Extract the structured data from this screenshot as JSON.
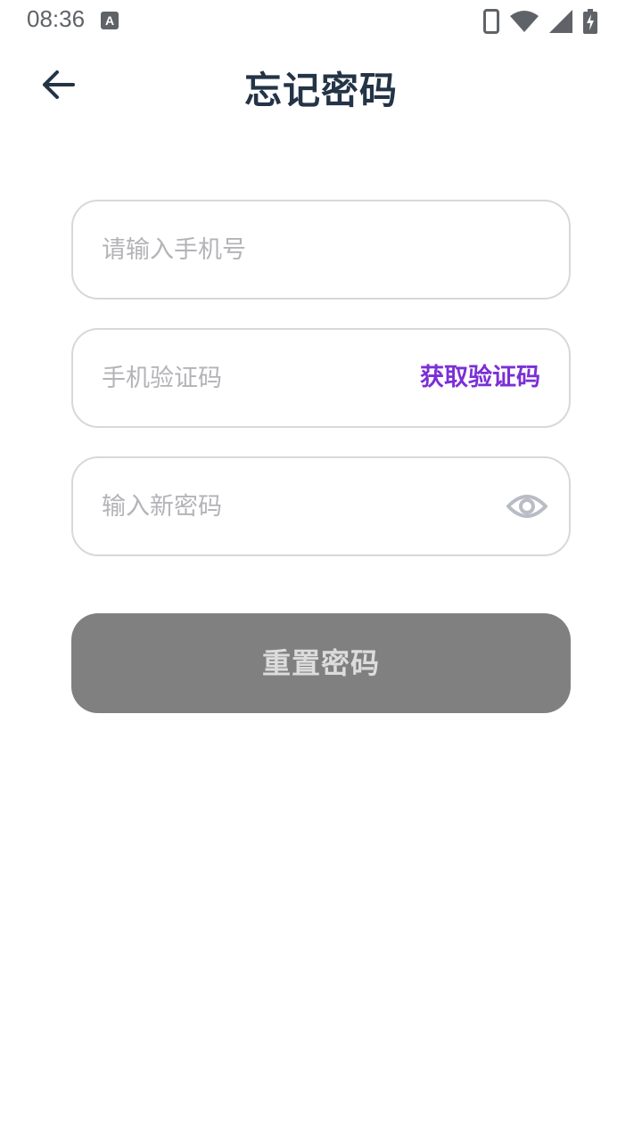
{
  "status_bar": {
    "time": "08:36",
    "notification_icon": "A",
    "icons": [
      "phone-icon",
      "wifi-icon",
      "signal-icon",
      "battery-charging-icon"
    ]
  },
  "header": {
    "title": "忘记密码",
    "back_icon": "arrow-left-icon"
  },
  "form": {
    "phone_placeholder": "请输入手机号",
    "code_placeholder": "手机验证码",
    "get_code_label": "获取验证码",
    "password_placeholder": "输入新密码",
    "password_toggle_icon": "eye-icon"
  },
  "actions": {
    "reset_label": "重置密码"
  },
  "colors": {
    "accent": "#7b2fd6",
    "title": "#243447",
    "button_disabled": "#808080",
    "border": "#d8d8dc",
    "placeholder": "#b3b3b8"
  }
}
